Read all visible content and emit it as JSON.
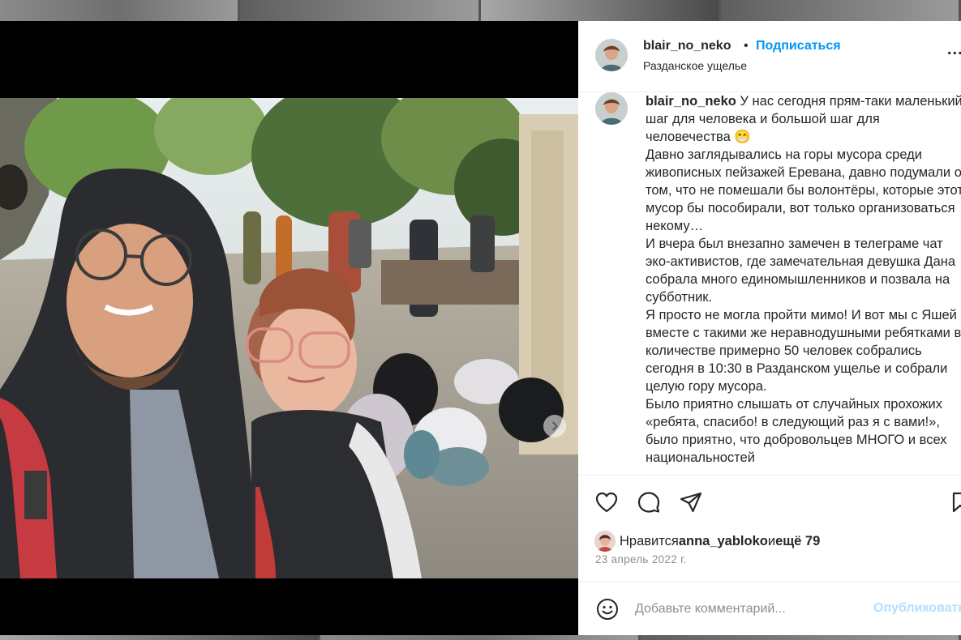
{
  "post": {
    "username": "blair_no_neko",
    "separator": "•",
    "follow_label": "Подписаться",
    "location": "Разданское ущелье",
    "more_label": "..."
  },
  "caption": {
    "username": "blair_no_neko",
    "text": " У нас сегодня прям-таки маленький шаг для человека и большой шаг для человечества 😁",
    "paragraphs": [
      "Давно заглядывались на горы мусора среди живописных пейзажей Еревана, давно подумали о том, что не помешали бы волонтёры, которые этот мусор бы пособирали, вот только организоваться некому…",
      "И вчера был внезапно замечен в телеграме чат эко-активистов, где замечательная девушка Дана собрала много единомышленников и позвала на субботник.",
      "Я просто не могла пройти мимо! И вот мы с Яшей вместе с такими же неравнодушными ребятками в количестве примерно 50 человек собрались сегодня в 10:30 в Разданском ущелье и собрали целую гору мусора.",
      "Было приятно слышать от случайных прохожих «ребята, спасибо! в следующий раз я с вами!», было приятно, что добровольцев МНОГО и всех национальностей"
    ]
  },
  "likes": {
    "prefix": "Нравится ",
    "user": "anna_yabloko",
    "middle": " и ",
    "rest": "ещё 79"
  },
  "date": "23 апрель 2022 г.",
  "comment": {
    "placeholder": "Добавьте комментарий...",
    "publish_label": "Опубликовать"
  },
  "icons": {
    "like": "heart-icon",
    "comment": "comment-icon",
    "share": "share-icon",
    "save": "bookmark-icon",
    "emoji": "emoji-icon",
    "next": "chevron-right-icon"
  },
  "colors": {
    "accent": "#0095f6",
    "publish_disabled": "#b2dffc",
    "muted": "#8e8e8e",
    "text": "#262626"
  }
}
